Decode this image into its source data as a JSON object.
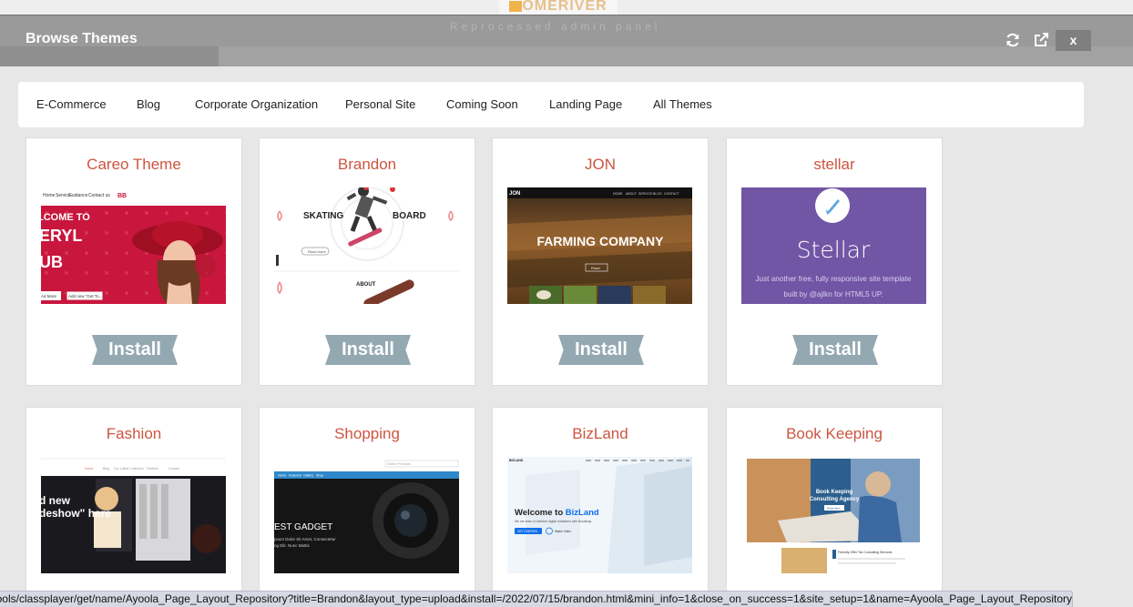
{
  "backdrop": {
    "logo_text": "OMERIVER",
    "watermark_text": "Reprocessed admin panel"
  },
  "modal": {
    "title": "Browse Themes",
    "close_label": "x",
    "icons": [
      "refresh-icon",
      "external-link-icon"
    ]
  },
  "tabs": [
    {
      "label": "E-Commerce"
    },
    {
      "label": "Blog"
    },
    {
      "label": "Corporate Organization"
    },
    {
      "label": "Personal Site"
    },
    {
      "label": "Coming Soon"
    },
    {
      "label": "Landing Page"
    },
    {
      "label": "All Themes"
    }
  ],
  "themes": [
    {
      "name": "Careo Theme",
      "install_label": "Install",
      "preview": {
        "nav": [
          "Home",
          "Service",
          "Guidance",
          "Contact us"
        ],
        "logo": "BB",
        "headline": [
          "LCOME TO",
          "ERYL",
          "UB"
        ],
        "buttons": [
          "Ad More",
          "Add new \"Get To..."
        ]
      }
    },
    {
      "name": "Brandon",
      "install_label": "Install",
      "preview": {
        "word_left": "SKATING",
        "word_right": "BOARD",
        "button": "Read more",
        "section": "ABOUT"
      }
    },
    {
      "name": "JON",
      "install_label": "Install",
      "preview": {
        "logo": "JON",
        "nav": [
          "HOME",
          "ABOUT",
          "SERVICE",
          "BLOG",
          "CONTACT"
        ],
        "headline": "FARMING COMPANY",
        "button": "Read"
      }
    },
    {
      "name": "stellar",
      "install_label": "Install",
      "preview": {
        "heading": "Stellar",
        "line1": "Just another free, fully responsive site template",
        "line2": "built by @ajlkn for HTML5 UP."
      }
    },
    {
      "name": "Fashion",
      "preview": {
        "nav": [
          "Home",
          "Blog",
          "Our Latest Collection",
          "Portfolio",
          "Contact"
        ],
        "headline": [
          "d new",
          "deshow\" here"
        ]
      }
    },
    {
      "name": "Shopping",
      "preview": {
        "search": "Search Products",
        "nav": [
          "Home",
          "Featured",
          "Gallery",
          "Shop"
        ],
        "headline": "EST GADGET",
        "sub1": "psum Dolor Sit Amet, Consectetur",
        "sub2": "ng Elit. Nunc Mattis"
      }
    },
    {
      "name": "BizLand",
      "preview": {
        "logo": "BIZLAND",
        "headline_prefix": "Welcome to ",
        "headline_brand": "BizLand",
        "sub": "We are team of talented digital marketers with Bootstrap",
        "button": "GET STARTED",
        "button2": "Watch Video"
      }
    },
    {
      "name": "Book Keeping",
      "preview": {
        "headline1": "Book Keeping",
        "headline2": "Consulting Agency",
        "button": "Read More",
        "sub": "Friendly Offer Tax Consulting Services"
      }
    }
  ],
  "status_url": "http://ayoola.com/tools/classplayer/get/name/Ayoola_Page_Layout_Repository?title=Brandon&layout_type=upload&install=/2022/07/15/brandon.html&mini_info=1&close_on_success=1&site_setup=1&name=Ayoola_Page_Layout_Repository",
  "colors": {
    "header": "#9a9a9a",
    "title_accent": "#cc5540",
    "install_button": "#94a8b2",
    "close_button": "#7f7f7f"
  }
}
